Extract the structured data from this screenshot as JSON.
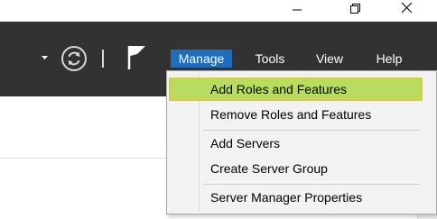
{
  "titlebar": {
    "minimize_icon": "minimize-icon",
    "restore_icon": "restore-icon",
    "close_icon": "close-icon"
  },
  "toolbar": {
    "dropdown_icon": "dropdown-arrow-icon",
    "refresh_icon": "refresh-icon",
    "flag_icon": "notification-flag-icon"
  },
  "menu": {
    "items": [
      {
        "label": "Manage",
        "active": true
      },
      {
        "label": "Tools",
        "active": false
      },
      {
        "label": "View",
        "active": false
      },
      {
        "label": "Help",
        "active": false
      }
    ]
  },
  "dropdown": {
    "items": [
      {
        "label": "Add Roles and Features",
        "highlighted": true
      },
      {
        "label": "Remove Roles and Features",
        "highlighted": false
      },
      {
        "label": "Add Servers",
        "highlighted": false
      },
      {
        "label": "Create Server Group",
        "highlighted": false
      },
      {
        "label": "Server Manager Properties",
        "highlighted": false
      }
    ]
  },
  "colors": {
    "header_bg": "#323232",
    "menu_active_bg": "#1e6ebd",
    "highlight_bg": "#b8dc60",
    "highlight_border": "#d8cc3c",
    "dropdown_bg": "#f2f2f2"
  }
}
